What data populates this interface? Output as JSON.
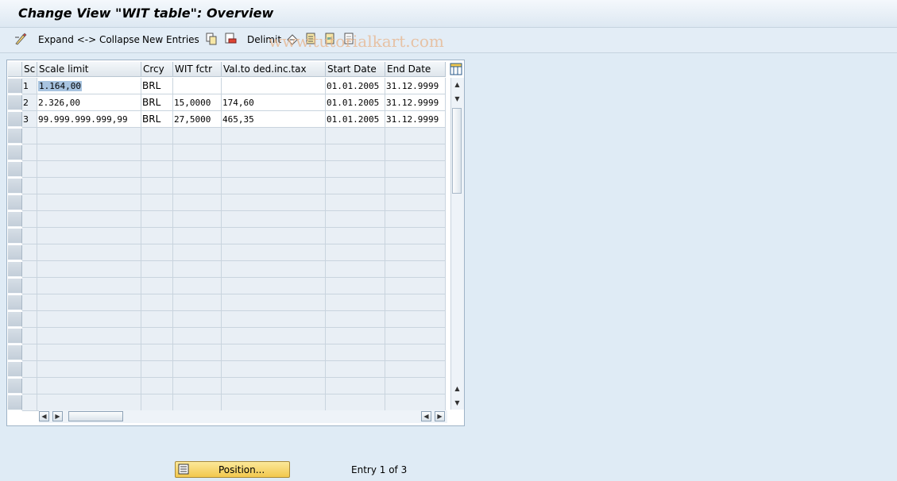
{
  "title": "Change View \"WIT table\": Overview",
  "toolbar": {
    "expand_collapse": "Expand <-> Collapse",
    "new_entries": "New Entries",
    "delimit": "Delimit"
  },
  "watermark": "www.tutorialkart.com",
  "table": {
    "headers": {
      "sc": "Sc",
      "scale_limit": "Scale limit",
      "crcy": "Crcy",
      "wit_fctr": "WIT fctr",
      "val_ded": "Val.to ded.inc.tax",
      "start_date": "Start Date",
      "end_date": "End Date"
    },
    "rows": [
      {
        "sc": "1",
        "scale_limit": "1.164,00",
        "crcy": "BRL",
        "wit_fctr": "",
        "val_ded": "",
        "start_date": "01.01.2005",
        "end_date": "31.12.9999"
      },
      {
        "sc": "2",
        "scale_limit": "2.326,00",
        "crcy": "BRL",
        "wit_fctr": "15,0000",
        "val_ded": "174,60",
        "start_date": "01.01.2005",
        "end_date": "31.12.9999"
      },
      {
        "sc": "3",
        "scale_limit": "99.999.999.999,99",
        "crcy": "BRL",
        "wit_fctr": "27,5000",
        "val_ded": "465,35",
        "start_date": "01.01.2005",
        "end_date": "31.12.9999"
      }
    ]
  },
  "footer": {
    "position_button": "Position...",
    "entry_info": "Entry 1 of 3"
  },
  "colors": {
    "background": "#dfebf5",
    "button": "#f2c84d",
    "selection": "#a8c4e0"
  }
}
